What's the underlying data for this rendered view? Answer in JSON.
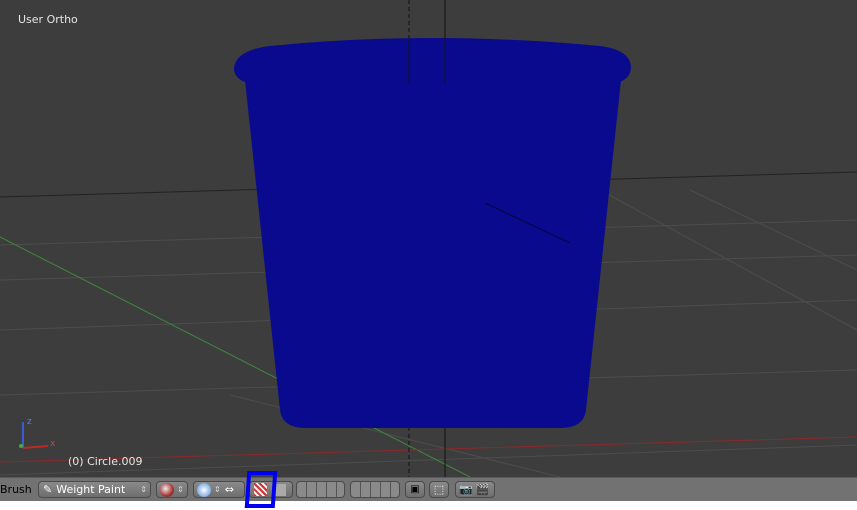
{
  "viewport": {
    "view_label": "User Ortho",
    "object_label": "(0) Circle.009",
    "axis_labels": {
      "z": "z",
      "x": "x"
    },
    "object_color": "#0a0a8e"
  },
  "toolbar": {
    "brush_label": "Brush",
    "mode_label": "Weight Paint",
    "highlight_color": "#0000f0",
    "icons": [
      "shading-sphere-icon",
      "pivot-icon",
      "manipulator-icon",
      "limit-selection-icon",
      "occlude-geometry-icon",
      "layers-icon",
      "layers-icon",
      "lock-camera-icon",
      "snap-icon",
      "render-icon",
      "clapper-icon"
    ]
  }
}
